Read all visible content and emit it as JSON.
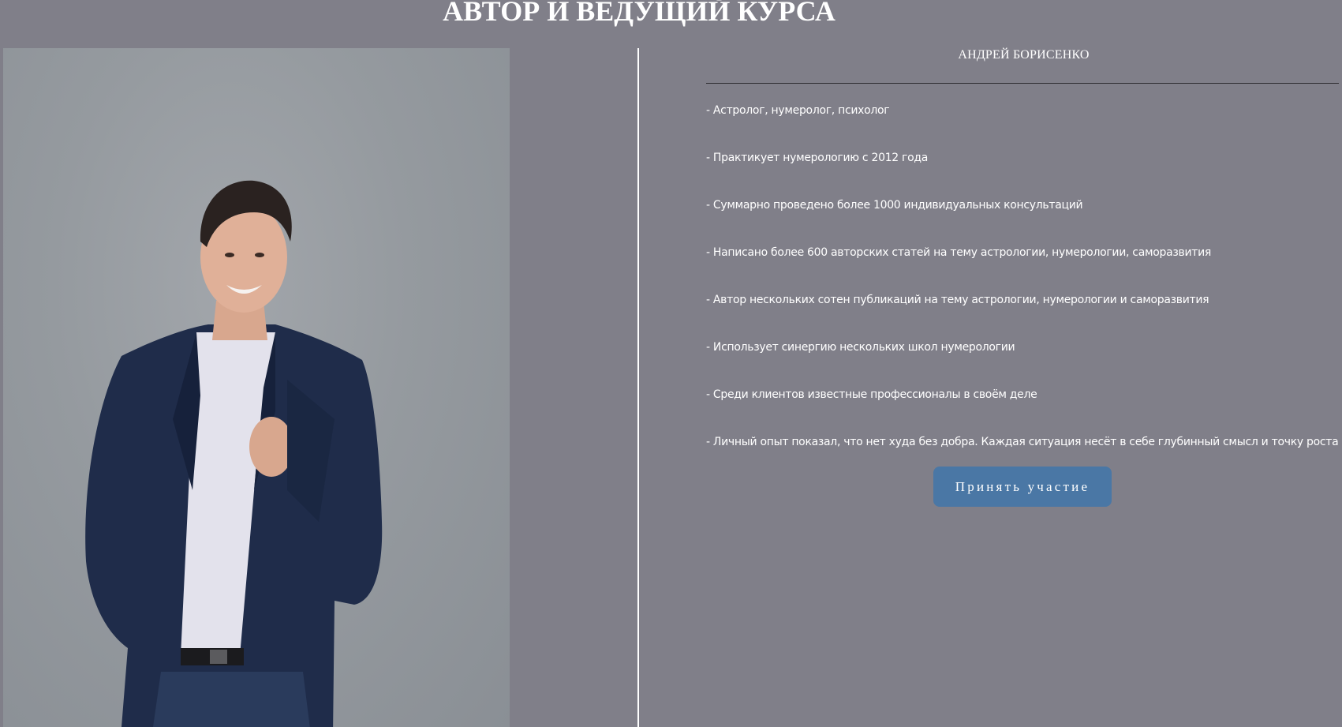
{
  "section": {
    "title": "АВТОР И ВЕДУЩИЙ КУРСА"
  },
  "author": {
    "name": "АНДРЕЙ БОРИСЕНКО",
    "facts": [
      "- Астролог, нумеролог, психолог",
      "- Практикует нумерологию с 2012 года",
      "- Суммарно проведено более 1000 индивидуальных консультаций",
      "- Написано более 600 авторских статей на тему астрологии, нумерологии, саморазвития",
      "- Автор нескольких сотен публикаций на тему астрологии, нумерологии и саморазвития",
      "- Использует синергию нескольких школ нумерологии",
      "- Среди клиентов известные профессионалы в своём деле",
      "- Личный опыт показал, что нет худа без добра. Каждая ситуация несёт в себе глубинный смысл и точку роста"
    ]
  },
  "cta": {
    "label": "Принять участие"
  },
  "colors": {
    "background": "#807f89",
    "button": "#4a77a5",
    "text": "#ffffff"
  }
}
